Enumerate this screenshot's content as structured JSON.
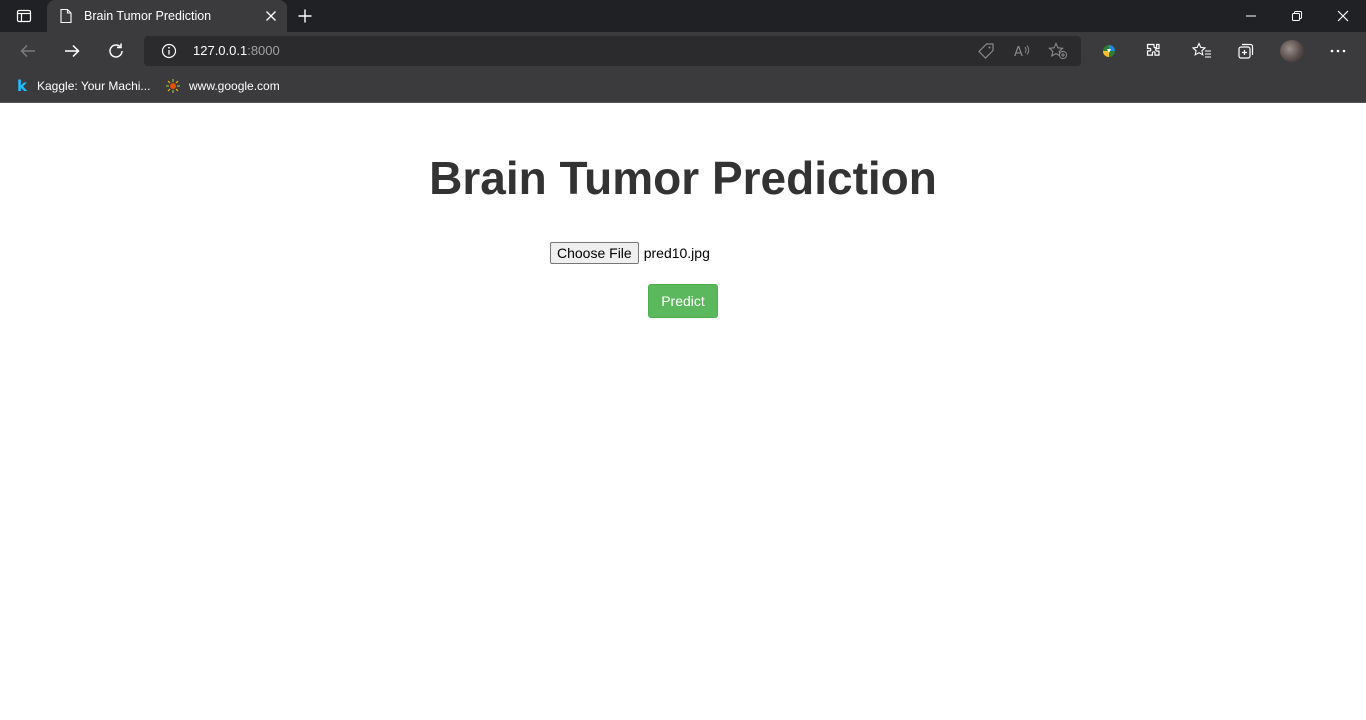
{
  "browser": {
    "tab": {
      "title": "Brain Tumor Prediction"
    },
    "address_bar": {
      "host": "127.0.0.1",
      "port": ":8000"
    },
    "bookmarks": [
      {
        "label": "Kaggle: Your Machi...",
        "icon": "kaggle-icon"
      },
      {
        "label": "www.google.com",
        "icon": "google-icon"
      }
    ]
  },
  "page": {
    "title": "Brain Tumor Prediction",
    "file_input": {
      "button_label": "Choose File",
      "selected_file": "pred10.jpg"
    },
    "predict_button": "Predict"
  },
  "colors": {
    "predict_button": "#5cb85c",
    "title_text": "#333333",
    "browser_chrome": "#3b3b3d"
  }
}
